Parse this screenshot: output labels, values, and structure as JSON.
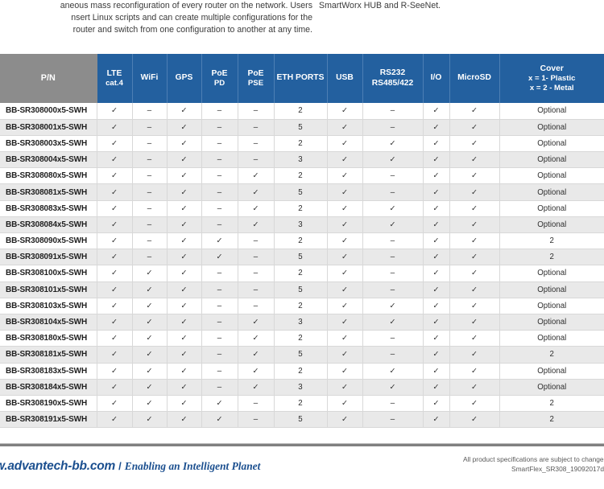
{
  "intro": {
    "left_lines": [
      "aneous mass reconfiguration of every router on the network. Users",
      "nsert Linux scripts and can create multiple configurations for the",
      "router and switch from one configuration to another at any time."
    ],
    "right_lines": [
      "SmartWorx HUB and R-SeeNet."
    ]
  },
  "colors": {
    "header_blue": "#23609f",
    "header_gray": "#8c8c8c",
    "row_alt": "#e9e9e9",
    "brand_blue": "#1b4f8f",
    "rule_gray": "#808080"
  },
  "table": {
    "columns": [
      {
        "key": "pn",
        "label": "P/N",
        "sub": ""
      },
      {
        "key": "lte",
        "label": "LTE",
        "sub": "cat.4"
      },
      {
        "key": "wifi",
        "label": "WiFi",
        "sub": ""
      },
      {
        "key": "gps",
        "label": "GPS",
        "sub": ""
      },
      {
        "key": "poe_pd",
        "label": "PoE",
        "sub": "PD"
      },
      {
        "key": "poe_pse",
        "label": "PoE",
        "sub": "PSE"
      },
      {
        "key": "eth",
        "label": "ETH PORTS",
        "sub": ""
      },
      {
        "key": "usb",
        "label": "USB",
        "sub": ""
      },
      {
        "key": "rs232",
        "label": "RS232",
        "sub": "RS485/422"
      },
      {
        "key": "io",
        "label": "I/O",
        "sub": ""
      },
      {
        "key": "microsd",
        "label": "MicroSD",
        "sub": ""
      },
      {
        "key": "cover",
        "label": "Cover",
        "sub": "x = 1- Plastic",
        "sub2": "x = 2 - Metal"
      }
    ],
    "check_glyph": "✓",
    "dash_glyph": "–",
    "rows": [
      {
        "pn": "BB-SR308000x5-SWH",
        "lte": "✓",
        "wifi": "–",
        "gps": "✓",
        "poe_pd": "–",
        "poe_pse": "–",
        "eth": "2",
        "usb": "✓",
        "rs232": "–",
        "io": "✓",
        "microsd": "✓",
        "cover": "Optional"
      },
      {
        "pn": "BB-SR308001x5-SWH",
        "lte": "✓",
        "wifi": "–",
        "gps": "✓",
        "poe_pd": "–",
        "poe_pse": "–",
        "eth": "5",
        "usb": "✓",
        "rs232": "–",
        "io": "✓",
        "microsd": "✓",
        "cover": "Optional"
      },
      {
        "pn": "BB-SR308003x5-SWH",
        "lte": "✓",
        "wifi": "–",
        "gps": "✓",
        "poe_pd": "–",
        "poe_pse": "–",
        "eth": "2",
        "usb": "✓",
        "rs232": "✓",
        "io": "✓",
        "microsd": "✓",
        "cover": "Optional"
      },
      {
        "pn": "BB-SR308004x5-SWH",
        "lte": "✓",
        "wifi": "–",
        "gps": "✓",
        "poe_pd": "–",
        "poe_pse": "–",
        "eth": "3",
        "usb": "✓",
        "rs232": "✓",
        "io": "✓",
        "microsd": "✓",
        "cover": "Optional"
      },
      {
        "pn": "BB-SR308080x5-SWH",
        "lte": "✓",
        "wifi": "–",
        "gps": "✓",
        "poe_pd": "–",
        "poe_pse": "✓",
        "eth": "2",
        "usb": "✓",
        "rs232": "–",
        "io": "✓",
        "microsd": "✓",
        "cover": "Optional"
      },
      {
        "pn": "BB-SR308081x5-SWH",
        "lte": "✓",
        "wifi": "–",
        "gps": "✓",
        "poe_pd": "–",
        "poe_pse": "✓",
        "eth": "5",
        "usb": "✓",
        "rs232": "–",
        "io": "✓",
        "microsd": "✓",
        "cover": "Optional"
      },
      {
        "pn": "BB-SR308083x5-SWH",
        "lte": "✓",
        "wifi": "–",
        "gps": "✓",
        "poe_pd": "–",
        "poe_pse": "✓",
        "eth": "2",
        "usb": "✓",
        "rs232": "✓",
        "io": "✓",
        "microsd": "✓",
        "cover": "Optional"
      },
      {
        "pn": "BB-SR308084x5-SWH",
        "lte": "✓",
        "wifi": "–",
        "gps": "✓",
        "poe_pd": "–",
        "poe_pse": "✓",
        "eth": "3",
        "usb": "✓",
        "rs232": "✓",
        "io": "✓",
        "microsd": "✓",
        "cover": "Optional"
      },
      {
        "pn": "BB-SR308090x5-SWH",
        "lte": "✓",
        "wifi": "–",
        "gps": "✓",
        "poe_pd": "✓",
        "poe_pse": "–",
        "eth": "2",
        "usb": "✓",
        "rs232": "–",
        "io": "✓",
        "microsd": "✓",
        "cover": "2"
      },
      {
        "pn": "BB-SR308091x5-SWH",
        "lte": "✓",
        "wifi": "–",
        "gps": "✓",
        "poe_pd": "✓",
        "poe_pse": "–",
        "eth": "5",
        "usb": "✓",
        "rs232": "–",
        "io": "✓",
        "microsd": "✓",
        "cover": "2"
      },
      {
        "pn": "BB-SR308100x5-SWH",
        "lte": "✓",
        "wifi": "✓",
        "gps": "✓",
        "poe_pd": "–",
        "poe_pse": "–",
        "eth": "2",
        "usb": "✓",
        "rs232": "–",
        "io": "✓",
        "microsd": "✓",
        "cover": "Optional"
      },
      {
        "pn": "BB-SR308101x5-SWH",
        "lte": "✓",
        "wifi": "✓",
        "gps": "✓",
        "poe_pd": "–",
        "poe_pse": "–",
        "eth": "5",
        "usb": "✓",
        "rs232": "–",
        "io": "✓",
        "microsd": "✓",
        "cover": "Optional"
      },
      {
        "pn": "BB-SR308103x5-SWH",
        "lte": "✓",
        "wifi": "✓",
        "gps": "✓",
        "poe_pd": "–",
        "poe_pse": "–",
        "eth": "2",
        "usb": "✓",
        "rs232": "✓",
        "io": "✓",
        "microsd": "✓",
        "cover": "Optional"
      },
      {
        "pn": "BB-SR308104x5-SWH",
        "lte": "✓",
        "wifi": "✓",
        "gps": "✓",
        "poe_pd": "–",
        "poe_pse": "✓",
        "eth": "3",
        "usb": "✓",
        "rs232": "✓",
        "io": "✓",
        "microsd": "✓",
        "cover": "Optional"
      },
      {
        "pn": "BB-SR308180x5-SWH",
        "lte": "✓",
        "wifi": "✓",
        "gps": "✓",
        "poe_pd": "–",
        "poe_pse": "✓",
        "eth": "2",
        "usb": "✓",
        "rs232": "–",
        "io": "✓",
        "microsd": "✓",
        "cover": "Optional"
      },
      {
        "pn": "BB-SR308181x5-SWH",
        "lte": "✓",
        "wifi": "✓",
        "gps": "✓",
        "poe_pd": "–",
        "poe_pse": "✓",
        "eth": "5",
        "usb": "✓",
        "rs232": "–",
        "io": "✓",
        "microsd": "✓",
        "cover": "2"
      },
      {
        "pn": "BB-SR308183x5-SWH",
        "lte": "✓",
        "wifi": "✓",
        "gps": "✓",
        "poe_pd": "–",
        "poe_pse": "✓",
        "eth": "2",
        "usb": "✓",
        "rs232": "✓",
        "io": "✓",
        "microsd": "✓",
        "cover": "Optional"
      },
      {
        "pn": "BB-SR308184x5-SWH",
        "lte": "✓",
        "wifi": "✓",
        "gps": "✓",
        "poe_pd": "–",
        "poe_pse": "✓",
        "eth": "3",
        "usb": "✓",
        "rs232": "✓",
        "io": "✓",
        "microsd": "✓",
        "cover": "Optional"
      },
      {
        "pn": "BB-SR308190x5-SWH",
        "lte": "✓",
        "wifi": "✓",
        "gps": "✓",
        "poe_pd": "✓",
        "poe_pse": "–",
        "eth": "2",
        "usb": "✓",
        "rs232": "–",
        "io": "✓",
        "microsd": "✓",
        "cover": "2"
      },
      {
        "pn": "BB-SR308191x5-SWH",
        "lte": "✓",
        "wifi": "✓",
        "gps": "✓",
        "poe_pd": "✓",
        "poe_pse": "–",
        "eth": "5",
        "usb": "✓",
        "rs232": "–",
        "io": "✓",
        "microsd": "✓",
        "cover": "2"
      }
    ]
  },
  "footer": {
    "url": "w.advantech-bb.com",
    "separator": "/",
    "tagline": "Enabling an Intelligent Planet",
    "legal_line1": "All product specifications are subject to change witl",
    "legal_line2": "SmartFlex_SR308_19092017d"
  }
}
